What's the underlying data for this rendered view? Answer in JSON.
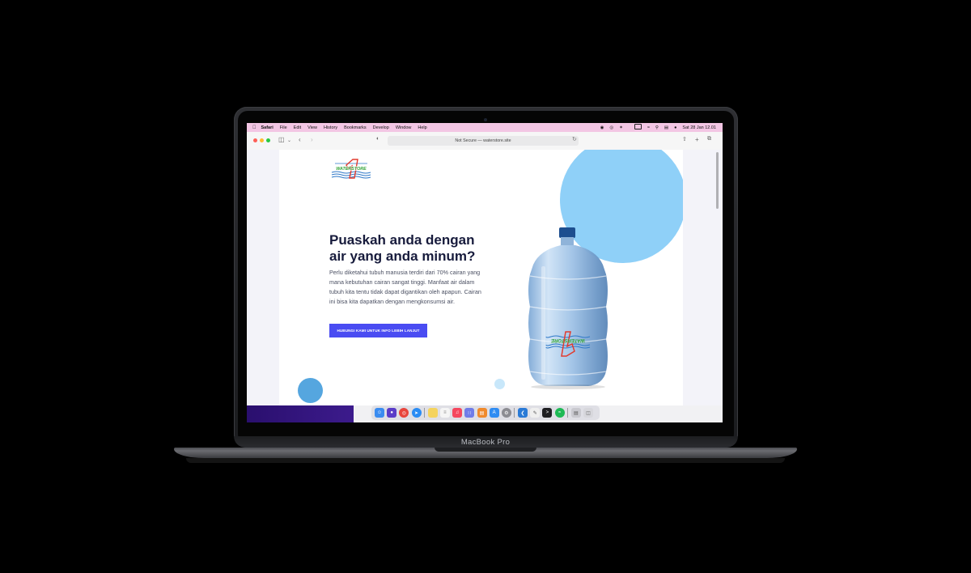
{
  "device": {
    "brand_label": "MacBook Pro"
  },
  "menubar": {
    "app_name": "Safari",
    "items": [
      "File",
      "Edit",
      "View",
      "History",
      "Bookmarks",
      "Develop",
      "Window",
      "Help"
    ],
    "status_icons": [
      "record-icon",
      "screen-icon",
      "bluetooth-icon",
      "battery-icon",
      "wifi-icon",
      "search-icon",
      "control-center-icon",
      "siri-icon"
    ],
    "clock": "Sat 28 Jan  12.01"
  },
  "browser": {
    "address_text": "Not Secure — waterstore.site",
    "toolbar_icons": [
      "sidebar-icon",
      "back-icon",
      "forward-icon",
      "shield-icon",
      "share-icon",
      "new-tab-icon",
      "tabs-overview-icon"
    ]
  },
  "page": {
    "headline": "Puaskah anda dengan air yang anda minum?",
    "paragraph": "Perlu diketahui tubuh manusia terdiri dari 70% cairan yang mana kebutuhan cairan sangat tinggi. Manfaat air dalam tubuh kita tentu tidak dapat digantikan oleh apapun. Cairan ini bisa kita dapatkan dengan mengkonsumsi air.",
    "cta_label": "HUBUNGI KAMI UNTUK INFO LEBIH LANJUT",
    "logo_text": "WATERSTORE",
    "colors": {
      "accent": "#4a4cf2",
      "heading": "#171b3c",
      "circle_large": "#8fd0f8",
      "circle_small": "#55a6df"
    }
  },
  "dock": {
    "apps": [
      {
        "name": "finder-icon",
        "color": "#3a8cf0"
      },
      {
        "name": "siri-icon",
        "color": "#5a3cc8"
      },
      {
        "name": "chrome-icon",
        "color": "#e8453c"
      },
      {
        "name": "safari-icon",
        "color": "#2a8cf4"
      },
      {
        "name": "photos-icon",
        "color": "#e8b93a"
      },
      {
        "name": "notes-icon",
        "color": "#f4d35e"
      },
      {
        "name": "reminders-icon",
        "color": "#f5f5f5"
      },
      {
        "name": "music-icon",
        "color": "#f5475e"
      },
      {
        "name": "launchpad-icon",
        "color": "#6f7ce8"
      },
      {
        "name": "books-icon",
        "color": "#f08a2c"
      },
      {
        "name": "app-store-icon",
        "color": "#2f8cf2"
      },
      {
        "name": "settings-icon",
        "color": "#8c8c92"
      },
      {
        "name": "vscode-icon",
        "color": "#2a7ad6"
      },
      {
        "name": "textedit-icon",
        "color": "#efefef"
      },
      {
        "name": "terminal-icon",
        "color": "#1f1f22"
      },
      {
        "name": "spotify-icon",
        "color": "#1db954"
      },
      {
        "name": "documents-icon",
        "color": "#c9c9cf"
      },
      {
        "name": "trash-icon",
        "color": "#d7d7dc"
      }
    ]
  }
}
